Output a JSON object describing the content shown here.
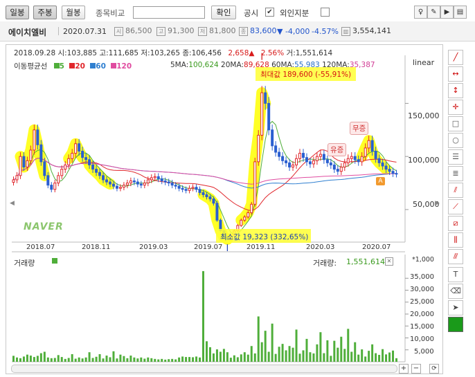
{
  "toolbar": {
    "period_tabs": [
      "일봉",
      "주봉",
      "월봉"
    ],
    "selected_tab": "주봉",
    "compare_label": "종목비교",
    "compare_input_value": "",
    "confirm_button": "확인",
    "disclosure_label": "공시",
    "disclosure_checked": true,
    "foreign_label": "외인지분",
    "foreign_checked": false,
    "right_icons": [
      "bulb-icon",
      "pen-icon",
      "cursor-tool-icon",
      "panel-icon"
    ]
  },
  "stock": {
    "name": "에이치엘비",
    "date": "2020.07.31",
    "open_label": "시",
    "open": "86,500",
    "high_label": "고",
    "high": "91,300",
    "low_label": "저",
    "low": "81,800",
    "close_label": "종",
    "close": "83,600",
    "change": "▼ -4,000",
    "change_pct": "-4.57%",
    "volume": "3,554,141"
  },
  "info_bar": {
    "date": "2018.09.28",
    "open": "시:103,885",
    "high": "고:111,685",
    "low": "저:103,265",
    "close": "종:106,456",
    "change": "2,658",
    "change_pct": "2.56%",
    "volume": "거:1,551,614"
  },
  "ma": {
    "title": "이동평균선",
    "periods": [
      {
        "label": "5",
        "color": "#4fae3a"
      },
      {
        "label": "20",
        "color": "#e0262b"
      },
      {
        "label": "60",
        "color": "#2f7fd0"
      },
      {
        "label": "120",
        "color": "#e04ca0"
      }
    ],
    "values": [
      {
        "label": "5MA:",
        "value": "100,624",
        "color": "#3a9a1e"
      },
      {
        "label": "20MA:",
        "value": "89,628",
        "color": "#d9181c"
      },
      {
        "label": "60MA:",
        "value": "55,983",
        "color": "#2a6fc6"
      },
      {
        "label": "120MA:",
        "value": "35,387",
        "color": "#d13a94"
      }
    ]
  },
  "scale_label": "linear",
  "annotations": {
    "max_value": "최대값 189,600 (-55,91%)",
    "min_value": "최소값 19,323 (332,65%)",
    "surge1": "무증",
    "surge2": "유증"
  },
  "watermark": "NAVER",
  "price_axis": [
    "150,000",
    "100,000",
    "50,000"
  ],
  "date_axis": [
    "2018.07",
    "2018.11",
    "2019.03",
    "2019.07",
    "2019.11",
    "2020.03",
    "2020.07"
  ],
  "volume_panel": {
    "label": "거래량",
    "readout_label": "거래량:",
    "readout_value": "1,551,614",
    "unit": "*1,000",
    "axis": [
      "35,000",
      "30,000",
      "25,000",
      "20,000",
      "15,000",
      "10,000",
      "5,000"
    ]
  },
  "chart_data": {
    "type": "candlestick",
    "x_range": [
      "2018.05",
      "2020.08"
    ],
    "price_ylim": [
      20000,
      190000
    ],
    "price_ticks": [
      50000,
      100000,
      150000
    ],
    "max_price": 189600,
    "min_price": 19323,
    "volume_ticks": [
      5000,
      10000,
      15000,
      20000,
      25000,
      30000,
      35000
    ],
    "weekly_close": [
      78000,
      82000,
      100000,
      90000,
      96000,
      106000,
      125000,
      111000,
      95000,
      82000,
      73000,
      69000,
      75000,
      82000,
      88000,
      92000,
      98000,
      103000,
      112000,
      105000,
      99000,
      97000,
      92000,
      88000,
      85000,
      82000,
      78000,
      76000,
      74000,
      72000,
      70000,
      71000,
      73000,
      75000,
      77000,
      76000,
      74000,
      73000,
      75000,
      78000,
      80000,
      81000,
      79000,
      77000,
      76000,
      75000,
      73000,
      72000,
      70000,
      69000,
      68000,
      70000,
      71000,
      69000,
      66000,
      64000,
      62000,
      60000,
      56000,
      40000,
      30000,
      24000,
      22000,
      26000,
      30000,
      35000,
      40000,
      43000,
      47000,
      55000,
      95000,
      120000,
      160000,
      150000,
      125000,
      110000,
      104000,
      100000,
      96000,
      94000,
      90000,
      92000,
      98000,
      103000,
      99000,
      95000,
      93000,
      96000,
      100000,
      102000,
      97000,
      94000,
      92000,
      88000,
      86000,
      90000,
      94000,
      98000,
      100000,
      97000,
      95000,
      100000,
      108000,
      115000,
      105000,
      98000,
      94000,
      91000,
      88000,
      86000,
      84000,
      83600
    ],
    "weekly_volume": [
      2500,
      1800,
      1500,
      2200,
      3000,
      2600,
      2000,
      2500,
      3600,
      4200,
      1800,
      1500,
      1600,
      2800,
      2000,
      1200,
      1600,
      3200,
      1300,
      1800,
      1400,
      1800,
      4000,
      1600,
      2100,
      3200,
      1400,
      2600,
      1900,
      4400,
      1400,
      3000,
      2400,
      1500,
      2600,
      1800,
      1400,
      1800,
      1300,
      1800,
      1500,
      1200,
      1000,
      1200,
      900,
      1100,
      1200,
      1000,
      1800,
      2200,
      2000,
      2000,
      1900,
      2200,
      1800,
      38000,
      8600,
      6100,
      3500,
      5200,
      4200,
      5400,
      4000,
      1700,
      2700,
      1900,
      3100,
      4000,
      3000,
      6600,
      3500,
      19000,
      8200,
      13000,
      4200,
      16000,
      3300,
      6300,
      7500,
      4800,
      6600,
      5900,
      13500,
      3400,
      4800,
      9600,
      4000,
      3500,
      7300,
      12400,
      3600,
      9000,
      2500,
      8800,
      5900,
      10500,
      5400,
      13800,
      4200,
      8200,
      3000,
      5200,
      2200,
      4600,
      7300,
      3600,
      2900,
      5300,
      3100,
      3900,
      4700,
      1500
    ]
  }
}
